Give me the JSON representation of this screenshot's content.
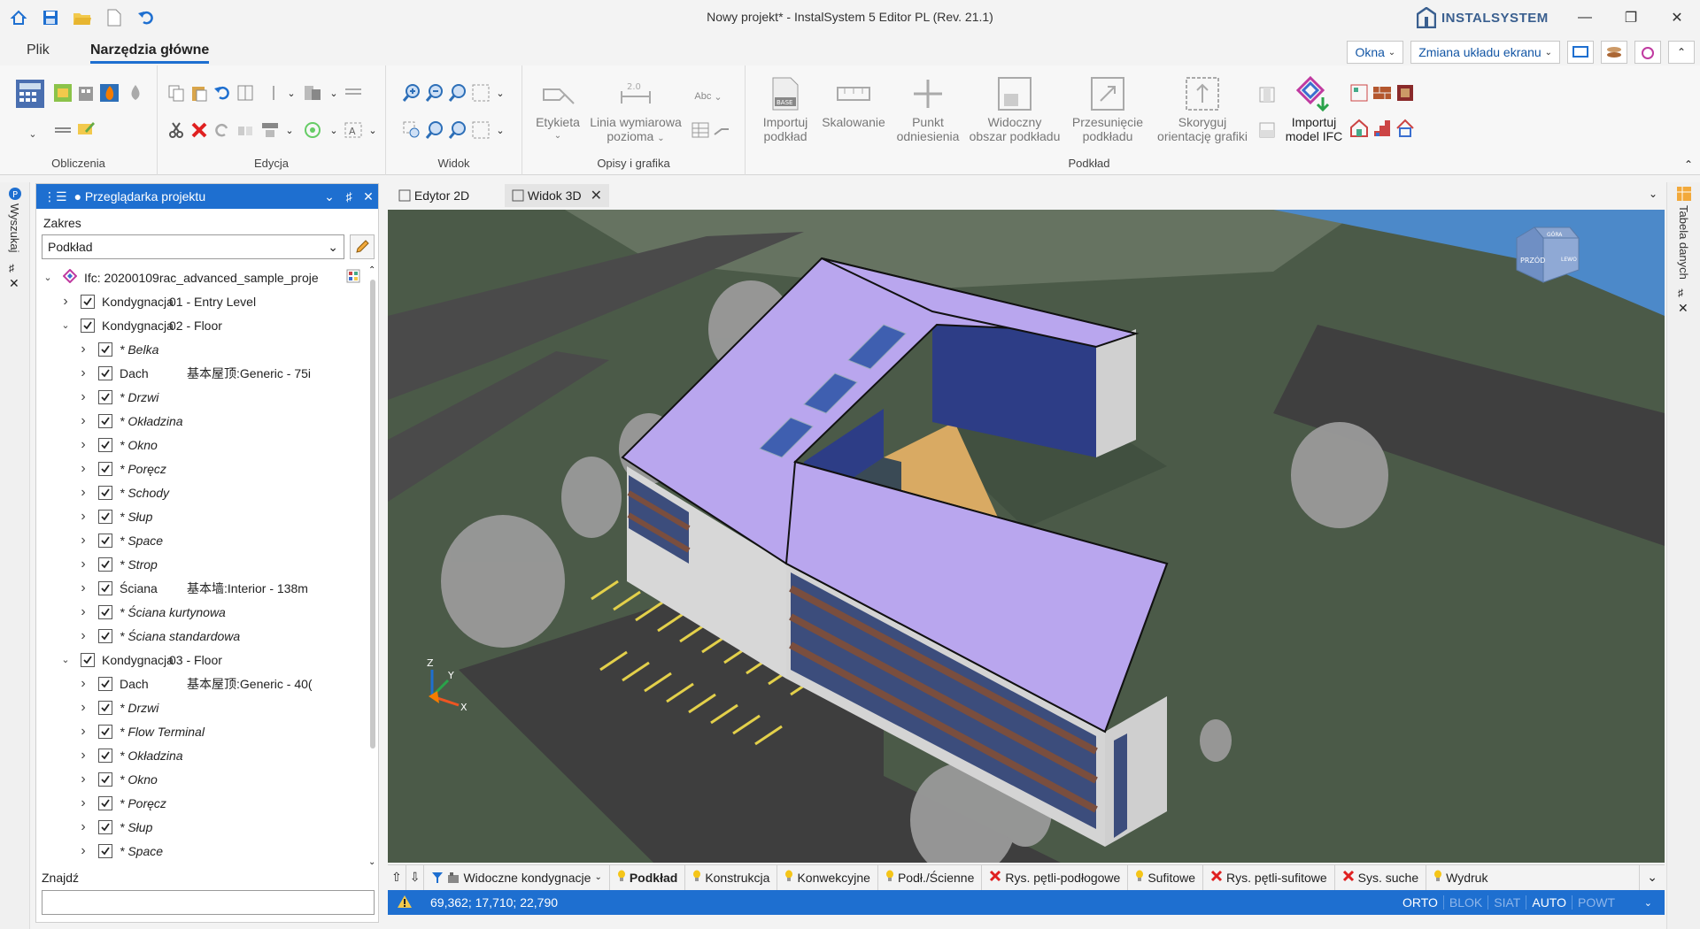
{
  "window": {
    "title": "Nowy projekt* - InstalSystem 5 Editor PL (Rev. 21.1)",
    "logo_text": "INSTALSYSTEM"
  },
  "ribbon_tabs": {
    "file": "Plik",
    "main": "Narzędzia główne"
  },
  "tab_right": {
    "windows": "Okna",
    "layout": "Zmiana układu ekranu"
  },
  "groups": {
    "calc": "Obliczenia",
    "edit": "Edycja",
    "view": "Widok",
    "desc": "Opisy i grafika",
    "base": "Podkład"
  },
  "buttons": {
    "label": "Etykieta",
    "dim_line_1": "Linia wymiarowa",
    "dim_line_2": "pozioma",
    "import_base_1": "Importuj",
    "import_base_2": "podkład",
    "scaling": "Skalowanie",
    "ref_point_1": "Punkt",
    "ref_point_2": "odniesienia",
    "visible_area_1": "Widoczny",
    "visible_area_2": "obszar podkładu",
    "move_base_1": "Przesunięcie",
    "move_base_2": "podkładu",
    "correct_orient_1": "Skoryguj",
    "correct_orient_2": "orientację grafiki",
    "import_ifc_1": "Importuj",
    "import_ifc_2": "model IFC",
    "abc": "Abc"
  },
  "left_strip": {
    "search": "Wyszukaj"
  },
  "right_strip": {
    "data_table": "Tabela danych"
  },
  "panel": {
    "title": "Przeglądarka projektu",
    "scope_label": "Zakres",
    "scope_value": "Podkład",
    "find_label": "Znajdź"
  },
  "tree": [
    {
      "level": 0,
      "expanded": true,
      "label": "Ifc: 20200109rac_advanced_sample_proje",
      "type": "root"
    },
    {
      "level": 1,
      "expanded": false,
      "label": "Kondygnacja",
      "extra": "01 - Entry Level"
    },
    {
      "level": 1,
      "expanded": true,
      "label": "Kondygnacja",
      "extra": "02 - Floor"
    },
    {
      "level": 2,
      "label": "* Belka",
      "italic": true
    },
    {
      "level": 2,
      "label": "Dach",
      "extra": "基本屋顶:Generic - 75i"
    },
    {
      "level": 2,
      "label": "* Drzwi",
      "italic": true
    },
    {
      "level": 2,
      "label": "* Okładzina",
      "italic": true
    },
    {
      "level": 2,
      "label": "* Okno",
      "italic": true
    },
    {
      "level": 2,
      "label": "* Poręcz",
      "italic": true
    },
    {
      "level": 2,
      "label": "* Schody",
      "italic": true
    },
    {
      "level": 2,
      "label": "* Słup",
      "italic": true
    },
    {
      "level": 2,
      "label": "* Space",
      "italic": true
    },
    {
      "level": 2,
      "label": "* Strop",
      "italic": true
    },
    {
      "level": 2,
      "label": "Ściana",
      "extra": "基本墙:Interior - 138m"
    },
    {
      "level": 2,
      "label": "* Ściana kurtynowa",
      "italic": true
    },
    {
      "level": 2,
      "label": "* Ściana standardowa",
      "italic": true
    },
    {
      "level": 1,
      "expanded": true,
      "label": "Kondygnacja",
      "extra": "03 - Floor"
    },
    {
      "level": 2,
      "label": "Dach",
      "extra": "基本屋顶:Generic - 40("
    },
    {
      "level": 2,
      "label": "* Drzwi",
      "italic": true
    },
    {
      "level": 2,
      "label": "* Flow Terminal",
      "italic": true
    },
    {
      "level": 2,
      "label": "* Okładzina",
      "italic": true
    },
    {
      "level": 2,
      "label": "* Okno",
      "italic": true
    },
    {
      "level": 2,
      "label": "* Poręcz",
      "italic": true
    },
    {
      "level": 2,
      "label": "* Słup",
      "italic": true
    },
    {
      "level": 2,
      "label": "* Space",
      "italic": true
    }
  ],
  "doc_tabs": [
    {
      "label": "Edytor 2D",
      "active": false
    },
    {
      "label": "Widok 3D",
      "active": true
    }
  ],
  "viewcube": {
    "front": "PRZÓD",
    "top": "GÓRA",
    "right": "LEWO"
  },
  "axes": {
    "x": "X",
    "y": "Y",
    "z": "Z"
  },
  "layers": {
    "visible_floors": "Widoczne kondygnacje",
    "items": [
      {
        "label": "Podkład",
        "active": true,
        "icon": "bulb"
      },
      {
        "label": "Konstrukcja",
        "icon": "bulb"
      },
      {
        "label": "Konwekcyjne",
        "icon": "bulb"
      },
      {
        "label": "Podł./Ścienne",
        "icon": "bulb"
      },
      {
        "label": "Rys. pętli-podłogowe",
        "icon": "cross"
      },
      {
        "label": "Sufitowe",
        "icon": "bulb"
      },
      {
        "label": "Rys. pętli-sufitowe",
        "icon": "cross"
      },
      {
        "label": "Sys. suche",
        "icon": "cross"
      },
      {
        "label": "Wydruk",
        "icon": "bulb"
      }
    ]
  },
  "status": {
    "coords": "69,362; 17,710; 22,790",
    "modes": [
      {
        "label": "ORTO",
        "on": true
      },
      {
        "label": "BLOK",
        "on": false
      },
      {
        "label": "SIAT",
        "on": false
      },
      {
        "label": "AUTO",
        "on": true
      },
      {
        "label": "POWT",
        "on": false
      }
    ]
  },
  "colors": {
    "accent": "#1e6fd0",
    "roof": "#b9a6ee",
    "grass": "#4a5a47",
    "courtyard": "#d9aa63"
  }
}
